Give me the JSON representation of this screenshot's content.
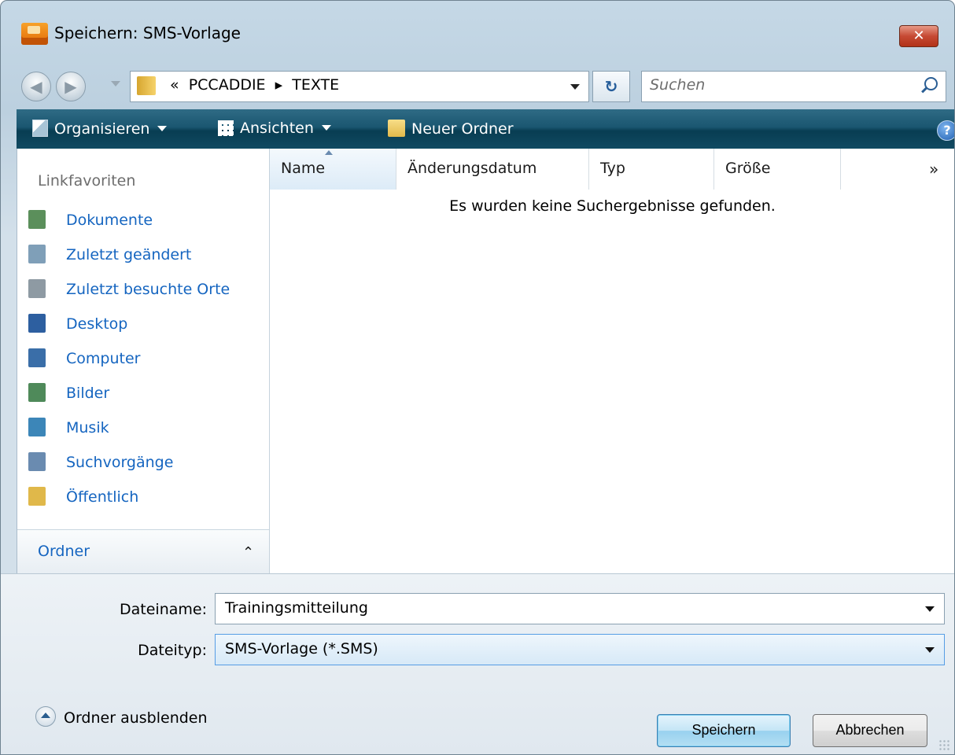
{
  "window": {
    "title": "Speichern: SMS-Vorlage",
    "close_label": "✕"
  },
  "nav": {
    "address_text": "«  PCCADDIE  ▸  TEXTE",
    "refresh_symbol": "↻",
    "search_placeholder": "Suchen"
  },
  "cmdbar": {
    "organize_label": "Organisieren",
    "views_label": "Ansichten",
    "new_folder_label": "Neuer Ordner",
    "help_symbol": "?"
  },
  "sidebar": {
    "title": "Linkfavoriten",
    "items": [
      {
        "label": "Dokumente",
        "icon": "documents-icon",
        "color": "#5b8f5b"
      },
      {
        "label": "Zuletzt geändert",
        "icon": "recent-changes-icon",
        "color": "#7f9fb8"
      },
      {
        "label": "Zuletzt besuchte Orte",
        "icon": "recent-places-icon",
        "color": "#8e9aa3"
      },
      {
        "label": "Desktop",
        "icon": "desktop-icon",
        "color": "#2d5fa0"
      },
      {
        "label": "Computer",
        "icon": "computer-icon",
        "color": "#3a6ea8"
      },
      {
        "label": "Bilder",
        "icon": "pictures-icon",
        "color": "#4f8a5a"
      },
      {
        "label": "Musik",
        "icon": "music-icon",
        "color": "#3c86b8"
      },
      {
        "label": "Suchvorgänge",
        "icon": "searches-icon",
        "color": "#6a8bb0"
      },
      {
        "label": "Öffentlich",
        "icon": "public-folder-icon",
        "color": "#e0b84a"
      }
    ],
    "folder_toggle_label": "Ordner",
    "folder_toggle_symbol": "⌃"
  },
  "table": {
    "columns": [
      "Name",
      "Änderungsdatum",
      "Typ",
      "Größe"
    ],
    "more_symbol": "»",
    "empty_message": "Es wurden keine Suchergebnisse gefunden."
  },
  "form": {
    "filename_label": "Dateiname:",
    "filename_value": "Trainingsmitteilung",
    "filetype_label": "Dateityp:",
    "filetype_value": "SMS-Vorlage (*.SMS)"
  },
  "footer": {
    "hide_folders_label": "Ordner ausblenden",
    "save_label": "Speichern",
    "cancel_label": "Abbrechen"
  }
}
